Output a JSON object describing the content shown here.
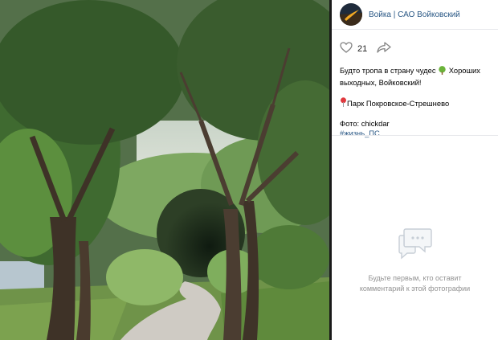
{
  "post": {
    "author": "Войка | САО Войковский",
    "like_count": "21",
    "caption_line1": "Будто тропа в страну чудес ",
    "caption_line1_after_icon": " Хороших",
    "caption_line2": "выходных, Войковский!",
    "location": "Парк Покровское-Стрешнево",
    "photo_credit": "Фото: chickdar",
    "hashtag": "#жизнь_ПС"
  },
  "comments": {
    "empty_line1": "Будьте первым, кто оставит",
    "empty_line2": "комментарий к этой фотографии"
  },
  "icons": {
    "like": "heart-icon",
    "share": "share-arrow-icon",
    "tree": "tree-emoji-icon",
    "pin": "pin-emoji-icon",
    "comments": "comment-bubble-icon"
  },
  "colors": {
    "link": "#2a5885",
    "muted": "#939393",
    "divider": "#1a1a1a"
  }
}
